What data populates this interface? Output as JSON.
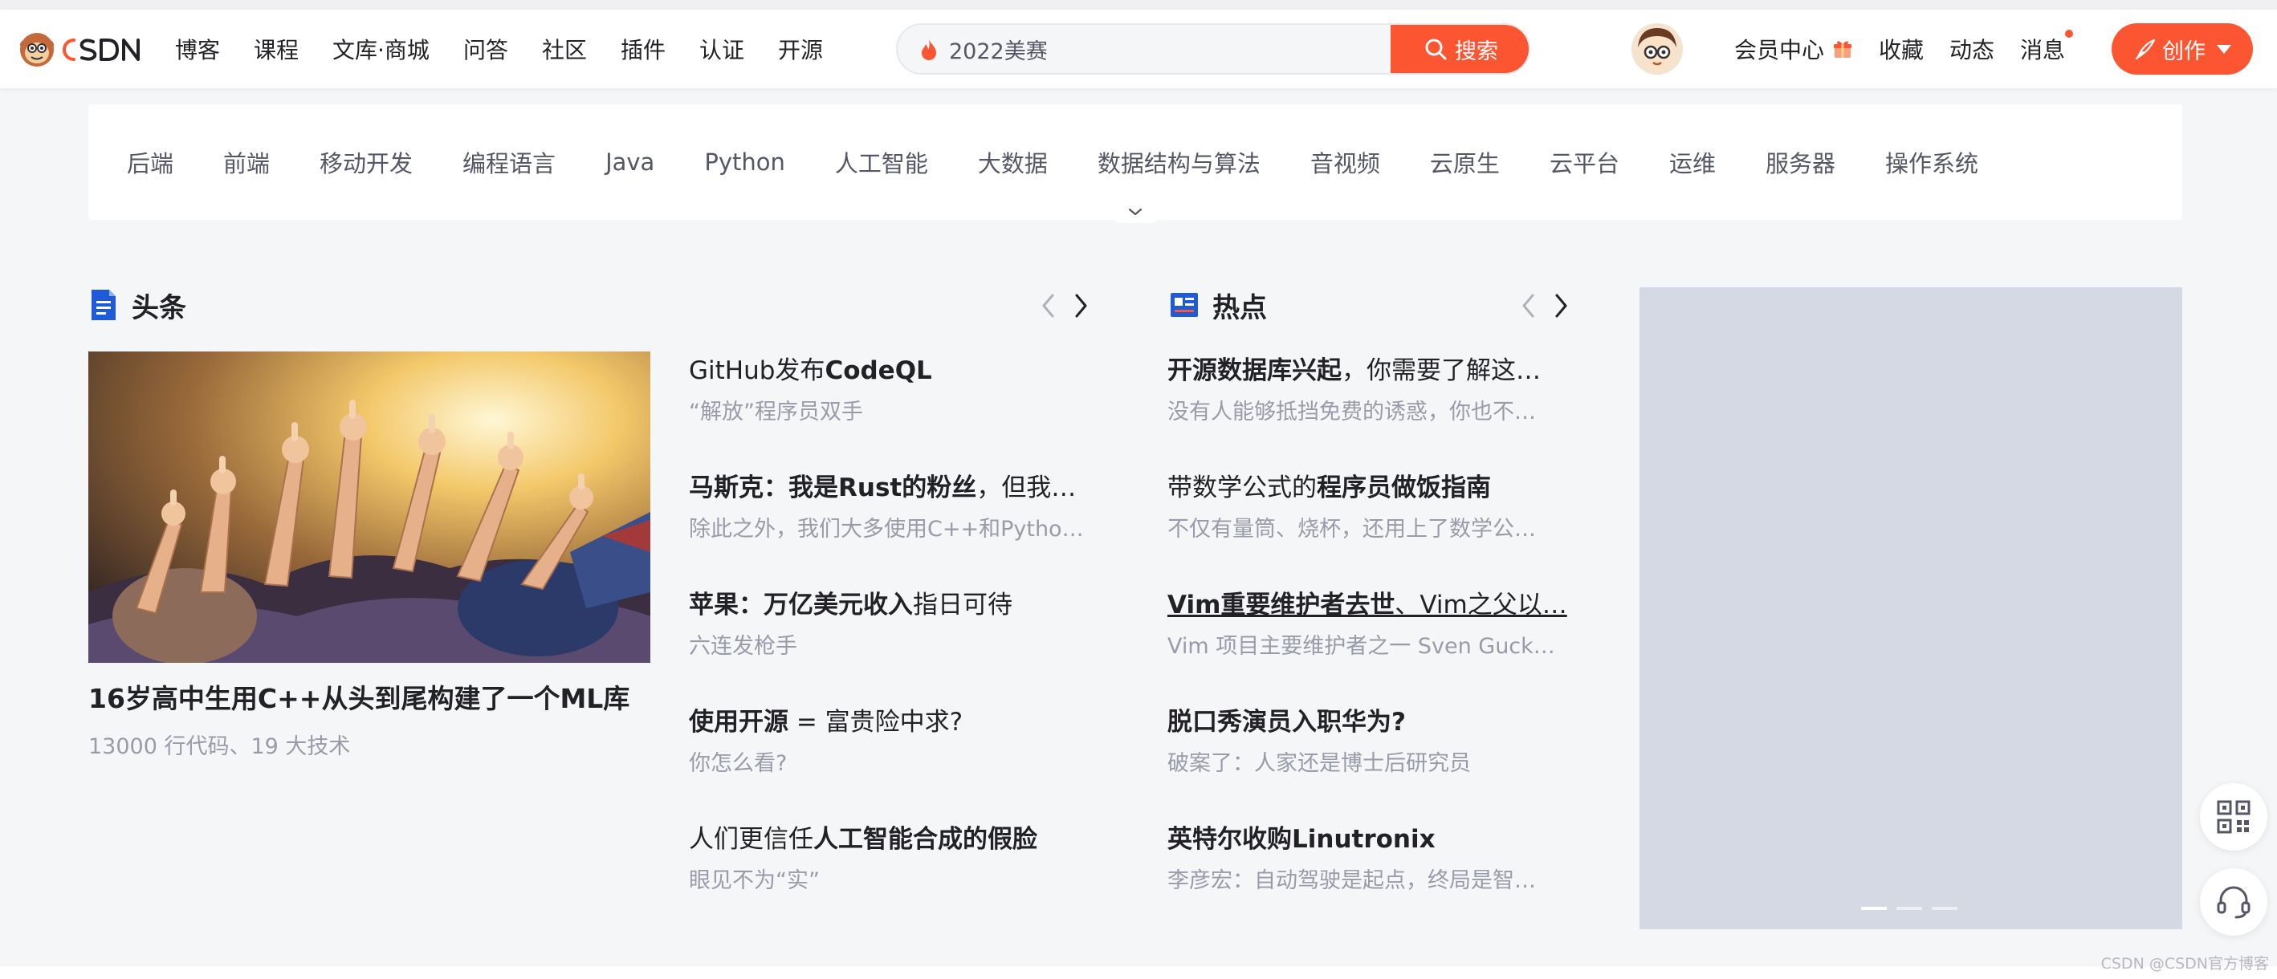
{
  "header": {
    "logo_text": "CSDN",
    "nav": [
      "博客",
      "课程",
      "文库·商城",
      "问答",
      "社区",
      "插件",
      "认证",
      "开源"
    ],
    "search": {
      "value": "2022美赛",
      "button": "搜索"
    },
    "right": {
      "vip": "会员中心",
      "favorites": "收藏",
      "dynamic": "动态",
      "messages": "消息"
    },
    "create": "创作"
  },
  "categories": [
    "后端",
    "前端",
    "移动开发",
    "编程语言",
    "Java",
    "Python",
    "人工智能",
    "大数据",
    "数据结构与算法",
    "音视频",
    "云原生",
    "云平台",
    "运维",
    "服务器",
    "操作系统"
  ],
  "headlines": {
    "title": "头条",
    "hero": {
      "title": "16岁高中生用C++从头到尾构建了一个ML库",
      "subtitle": "13000 行代码、19 大技术"
    },
    "items": [
      {
        "pre": "GitHub发布",
        "bold": "CodeQL",
        "post": "",
        "desc": "“解放”程序员双手"
      },
      {
        "pre": "",
        "bold": "马斯克：我是Rust的粉丝",
        "post": "，但我…",
        "desc": "除此之外，我们大多使用C++和Pytho…"
      },
      {
        "pre": "",
        "bold": "苹果：万亿美元收入",
        "post": "指日可待",
        "desc": "六连发枪手"
      },
      {
        "pre": "",
        "bold": "使用开源",
        "post": " = 富贵险中求?",
        "desc": "你怎么看?"
      },
      {
        "pre": "人们更信任",
        "bold": "人工智能合成的假脸",
        "post": "",
        "desc": "眼见不为“实”"
      }
    ]
  },
  "hot": {
    "title": "热点",
    "items": [
      {
        "pre": "",
        "bold": "开源数据库兴起",
        "post": "，你需要了解这…",
        "desc": "没有人能够抵挡免费的诱惑，你也不…"
      },
      {
        "pre": "带数学公式的",
        "bold": "程序员做饭指南",
        "post": "",
        "desc": "不仅有量筒、烧杯，还用上了数学公…"
      },
      {
        "pre": "",
        "bold": "Vim重要维护者去世",
        "post": "、Vim之父以…",
        "desc": "Vim 项目主要维护者之一 Sven Guck…"
      },
      {
        "pre": "",
        "bold": "脱口秀演员入职华为?",
        "post": "",
        "desc": "破案了：人家还是博士后研究员"
      },
      {
        "pre": "",
        "bold": "英特尔收购Linutronix",
        "post": "",
        "desc": "李彦宏：自动驾驶是起点，终局是智…"
      }
    ]
  },
  "banner": {
    "slides": 3,
    "active": 1
  },
  "watermark": "CSDN @CSDN官方博客",
  "colors": {
    "brand": "#fc5531",
    "text": "#222226",
    "muted": "#999aaa",
    "bg": "#f5f6f7"
  }
}
